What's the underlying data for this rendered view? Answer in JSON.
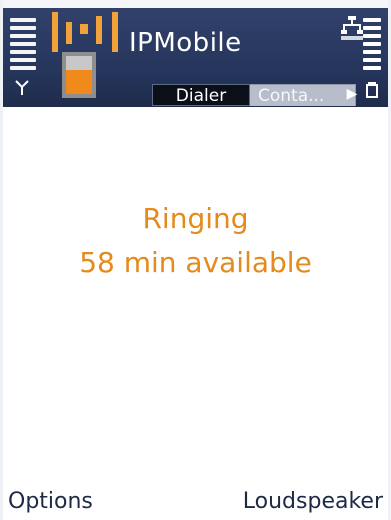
{
  "app": {
    "title": "IPMobile"
  },
  "tabs": [
    {
      "label": "Dialer",
      "selected": true
    },
    {
      "label": "Conta...",
      "selected": false
    }
  ],
  "status": {
    "line1": "Ringing",
    "line2": "58 min available"
  },
  "softkeys": {
    "left": "Options",
    "right": "Loudspeaker"
  },
  "colors": {
    "header_blue": "#26355a",
    "accent_orange": "#e58a1c",
    "softkey_text": "#1d2a45"
  },
  "icons": {
    "signal": "signal-bars-icon",
    "antenna": "antenna-icon",
    "battery": "battery-bars-icon",
    "app": "ipmobile-app-icon",
    "connection": "connection-icon",
    "tab_scroll": "chevron-right-icon"
  }
}
